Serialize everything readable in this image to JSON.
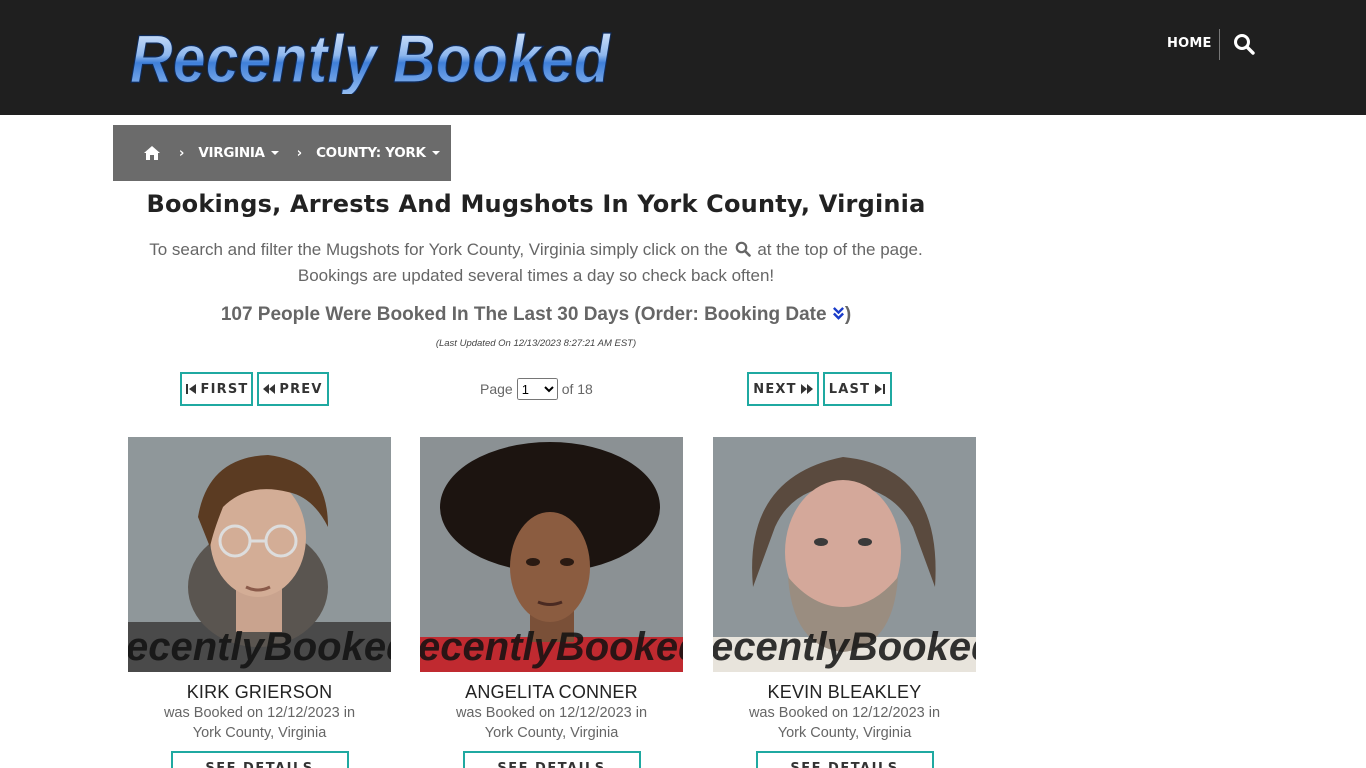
{
  "site": {
    "logo_text": "Recently Booked",
    "nav_home": "HOME",
    "search_icon": "search-icon"
  },
  "breadcrumb": {
    "home_icon": "home-icon",
    "items": [
      "VIRGINIA",
      "COUNTY: YORK"
    ]
  },
  "main": {
    "title": "Bookings, Arrests And Mugshots In York County, Virginia",
    "intro_before": "To search and filter the Mugshots for York County, Virginia simply click on the",
    "intro_after": "at the top of the page. Bookings are updated several times a day so check back often!",
    "count_text": "107 People Were Booked In The Last 30 Days (Order: Booking Date",
    "count_close": ")",
    "updated": "(Last Updated On 12/13/2023 8:27:21 AM EST)"
  },
  "pager": {
    "first": "FIRST",
    "prev": "PREV",
    "next": "NEXT",
    "last": "LAST",
    "page_label": "Page",
    "current_page": "1",
    "of_label": "of 18"
  },
  "watermark": "ecentlyBooked.co",
  "bookings": [
    {
      "name": "KIRK GRIERSON",
      "line1": "was Booked on 12/12/2023 in",
      "line2": "York County, Virginia",
      "button": "SEE DETAILS"
    },
    {
      "name": "ANGELITA CONNER",
      "line1": "was Booked on 12/12/2023 in",
      "line2": "York County, Virginia",
      "button": "SEE DETAILS"
    },
    {
      "name": "KEVIN BLEAKLEY",
      "line1": "was Booked on 12/12/2023 in",
      "line2": "York County, Virginia",
      "button": "SEE DETAILS"
    }
  ],
  "colors": {
    "header_bg": "#1f1f1f",
    "breadcrumb_bg": "#6b6b6b",
    "button_border": "#1fa9a1",
    "order_link": "#1a3cc9"
  }
}
